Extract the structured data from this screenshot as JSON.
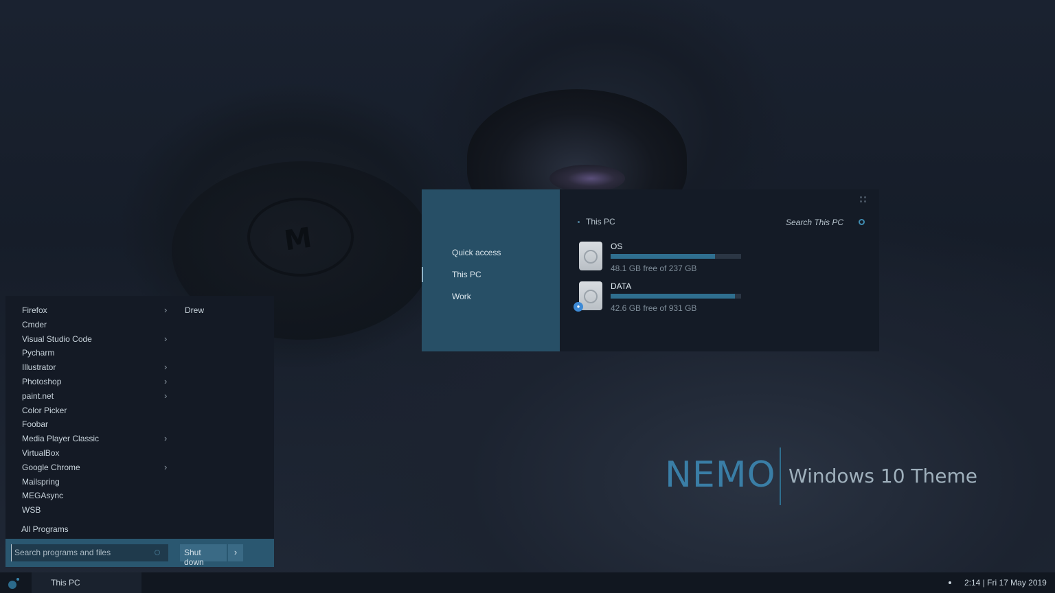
{
  "explorer": {
    "nav_items": [
      "Quick access",
      "This PC",
      "Work"
    ],
    "breadcrumb": "This PC",
    "search_placeholder": "Search This PC",
    "drives": [
      {
        "name": "OS",
        "free_text": "48.1 GB free of 237 GB",
        "used_fraction": 0.8
      },
      {
        "name": "DATA",
        "free_text": "42.6 GB free of 931 GB",
        "used_fraction": 0.95
      }
    ]
  },
  "brand": {
    "name": "NEMO",
    "subtitle": "Windows 10 Theme"
  },
  "start_menu": {
    "programs": [
      {
        "label": "Firefox",
        "has_submenu": true
      },
      {
        "label": "Cmder",
        "has_submenu": false
      },
      {
        "label": "Visual Studio Code",
        "has_submenu": true
      },
      {
        "label": "Pycharm",
        "has_submenu": false
      },
      {
        "label": "Illustrator",
        "has_submenu": true
      },
      {
        "label": "Photoshop",
        "has_submenu": true
      },
      {
        "label": "paint.net",
        "has_submenu": true
      },
      {
        "label": "Color Picker",
        "has_submenu": false
      },
      {
        "label": "Foobar",
        "has_submenu": false
      },
      {
        "label": "Media Player Classic",
        "has_submenu": true
      },
      {
        "label": "VirtualBox",
        "has_submenu": false
      },
      {
        "label": "Google Chrome",
        "has_submenu": true
      },
      {
        "label": "Mailspring",
        "has_submenu": false
      },
      {
        "label": "MEGAsync",
        "has_submenu": false
      },
      {
        "label": "WSB",
        "has_submenu": false
      }
    ],
    "submenu_arrow": "›",
    "user_name": "Drew",
    "all_programs": "All Programs",
    "search_placeholder": "Search programs and files",
    "shutdown_label": "Shut down",
    "shutdown_arrow": "›"
  },
  "taskbar": {
    "active_window": "This PC",
    "clock": "2:14  |  Fri 17 May 2019"
  },
  "colors": {
    "accent": "#274f66",
    "accent_light": "#3a7ea6",
    "panel": "#141a25"
  }
}
